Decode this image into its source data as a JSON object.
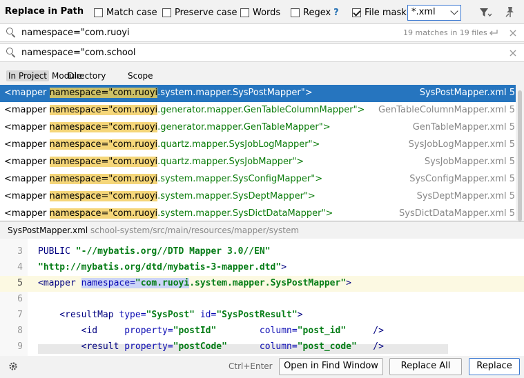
{
  "header": {
    "title": "Replace in Path",
    "options": [
      {
        "label": "Match case",
        "checked": false
      },
      {
        "label": "Preserve case",
        "checked": false
      },
      {
        "label": "Words",
        "checked": false
      },
      {
        "label": "Regex",
        "checked": false
      }
    ],
    "regex_help": "?",
    "file_mask_label": "File mask:",
    "file_mask_checked": true,
    "file_mask_value": "*.xml"
  },
  "search": {
    "find_text": "namespace=\"com.ruoyi",
    "match_count": "19 matches in 19 files",
    "replace_text": "namespace=\"com.school"
  },
  "scopes": [
    "In Project",
    "Module",
    "Directory",
    "Scope"
  ],
  "results": [
    {
      "prefix": "<mapper ",
      "match": "namespace=\"com.ruoyi",
      "rest": ".system.mapper.SysPostMapper\">",
      "file": "SysPostMapper.xml 5",
      "selected": true
    },
    {
      "prefix": "<mapper ",
      "match": "namespace=\"com.ruoyi",
      "rest": ".generator.mapper.GenTableColumnMapper\">",
      "file": "GenTableColumnMapper.xml 5",
      "selected": false
    },
    {
      "prefix": "<mapper ",
      "match": "namespace=\"com.ruoyi",
      "rest": ".generator.mapper.GenTableMapper\">",
      "file": "GenTableMapper.xml 5",
      "selected": false
    },
    {
      "prefix": "<mapper ",
      "match": "namespace=\"com.ruoyi",
      "rest": ".quartz.mapper.SysJobLogMapper\">",
      "file": "SysJobLogMapper.xml 5",
      "selected": false
    },
    {
      "prefix": "<mapper ",
      "match": "namespace=\"com.ruoyi",
      "rest": ".quartz.mapper.SysJobMapper\">",
      "file": "SysJobMapper.xml 5",
      "selected": false
    },
    {
      "prefix": "<mapper ",
      "match": "namespace=\"com.ruoyi",
      "rest": ".system.mapper.SysConfigMapper\">",
      "file": "SysConfigMapper.xml 5",
      "selected": false
    },
    {
      "prefix": "<mapper ",
      "match": "namespace=\"com.ruoyi",
      "rest": ".system.mapper.SysDeptMapper\">",
      "file": "SysDeptMapper.xml 5",
      "selected": false
    },
    {
      "prefix": "<mapper ",
      "match": "namespace=\"com.ruoyi",
      "rest": ".system.mapper.SysDictDataMapper\">",
      "file": "SysDictDataMapper.xml 5",
      "selected": false
    }
  ],
  "preview": {
    "file_name": "SysPostMapper.xml",
    "file_path": "school-system/src/main/resources/mapper/system",
    "lines": [
      {
        "n": "3",
        "t1": "PUBLIC ",
        "s1": "\"-//mybatis.org//DTD Mapper 3.0//EN\""
      },
      {
        "n": "4",
        "s1": "\"http://mybatis.org/dtd/mybatis-3-mapper.dtd\"",
        "t2": ">"
      },
      {
        "n": "5",
        "t1": "<mapper ",
        "a1": "namespace=",
        "s1": "\"com.ruoyi",
        "s2": ".system.mapper.SysPostMapper\"",
        "t2": ">"
      },
      {
        "n": "6"
      },
      {
        "n": "7",
        "t1": "    <resultMap ",
        "a1": "type=",
        "s1": "\"SysPost\" ",
        "a2": "id=",
        "s2": "\"SysPostResult\"",
        "t2": ">"
      },
      {
        "n": "8",
        "t1": "        <id     ",
        "a1": "property=",
        "s1": "\"postId\"        ",
        "a2": "column=",
        "s2": "\"post_id\"",
        "t2": "     />"
      },
      {
        "n": "9",
        "t1": "        <result ",
        "a1": "property=",
        "s1": "\"postCode\"      ",
        "a2": "column=",
        "s2": "\"post_code\"",
        "t2": "   />"
      }
    ]
  },
  "footer": {
    "shortcut": "Ctrl+Enter",
    "open_in_find_window": "Open in Find Window",
    "replace_all": "Replace All",
    "replace": "Replace"
  }
}
